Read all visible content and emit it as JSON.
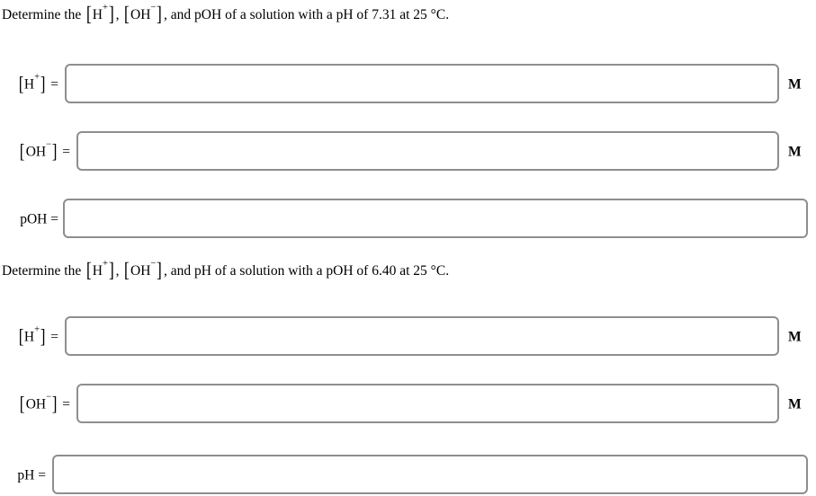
{
  "background_color": "#ffffff",
  "text_color": "#000000",
  "box_border_color": "#8e8e8e",
  "questions": [
    {
      "id": "question-1",
      "prompt_lead": "Determine the",
      "species_1": {
        "open": "[",
        "base": "H",
        "sup": "+",
        "close": "]"
      },
      "separator_1": ", ",
      "species_2": {
        "open": "[",
        "base": "OH",
        "sup": "−",
        "close": "]"
      },
      "prompt_tail": ", and pOH of a solution with a pH of 7.31 at 25 °C.",
      "given_quantity": "pH",
      "given_value": "7.31",
      "temperature": "25 °C",
      "rows": [
        {
          "id": "q1-h-plus",
          "label_open": "[",
          "label_base": "H",
          "label_sup": "+",
          "label_close": "]",
          "equals": " =",
          "value": "",
          "placeholder": "",
          "unit": "M"
        },
        {
          "id": "q1-oh-minus",
          "label_open": "[",
          "label_base": "OH",
          "label_sup": "−",
          "label_close": "]",
          "equals": " =",
          "value": "",
          "placeholder": "",
          "unit": "M"
        },
        {
          "id": "q1-poh",
          "label_plain": "pOH",
          "equals": " =",
          "value": "",
          "placeholder": "",
          "unit": ""
        }
      ]
    },
    {
      "id": "question-2",
      "prompt_lead": "Determine the",
      "species_1": {
        "open": "[",
        "base": "H",
        "sup": "+",
        "close": "]"
      },
      "separator_1": ", ",
      "species_2": {
        "open": "[",
        "base": "OH",
        "sup": "−",
        "close": "]"
      },
      "prompt_tail": ", and pH of a solution with a pOH of 6.40 at 25 °C.",
      "given_quantity": "pOH",
      "given_value": "6.40",
      "temperature": "25 °C",
      "rows": [
        {
          "id": "q2-h-plus",
          "label_open": "[",
          "label_base": "H",
          "label_sup": "+",
          "label_close": "]",
          "equals": " =",
          "value": "",
          "placeholder": "",
          "unit": "M"
        },
        {
          "id": "q2-oh-minus",
          "label_open": "[",
          "label_base": "OH",
          "label_sup": "−",
          "label_close": "]",
          "equals": " =",
          "value": "",
          "placeholder": "",
          "unit": "M"
        },
        {
          "id": "q2-ph",
          "label_plain": "pH",
          "equals": " =",
          "value": "",
          "placeholder": "",
          "unit": ""
        }
      ]
    }
  ]
}
